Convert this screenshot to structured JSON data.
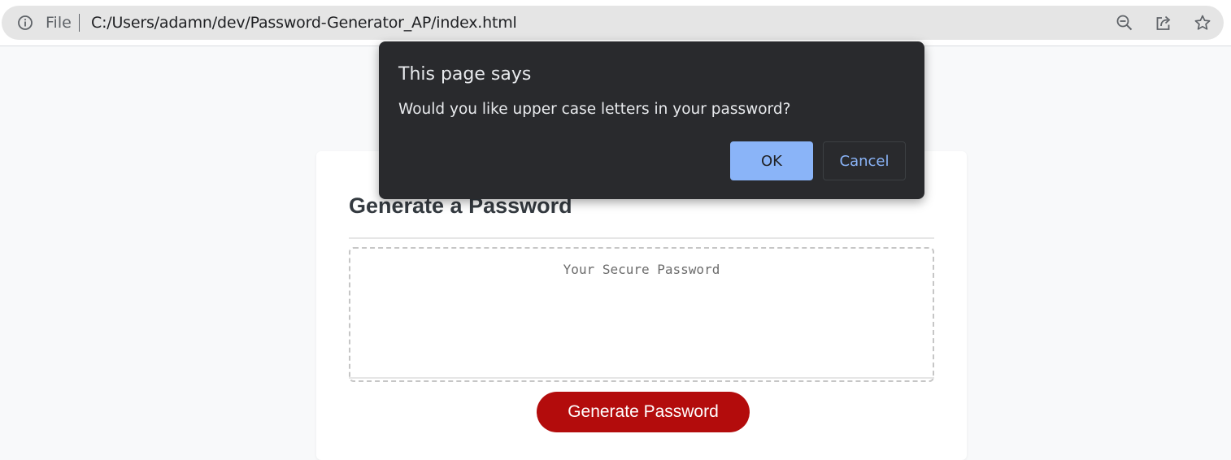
{
  "browser": {
    "scheme_label": "File",
    "url": "C:/Users/adamn/dev/Password-Generator_AP/index.html",
    "icons": [
      "info-icon",
      "zoom-icon",
      "share-icon",
      "star-icon"
    ]
  },
  "card": {
    "title": "Generate a Password",
    "password_placeholder": "Your Secure Password",
    "generate_label": "Generate Password",
    "accent": "#b30c0c"
  },
  "dialog": {
    "title": "This page says",
    "message": "Would you like upper case letters in your password?",
    "ok_label": "OK",
    "cancel_label": "Cancel"
  }
}
